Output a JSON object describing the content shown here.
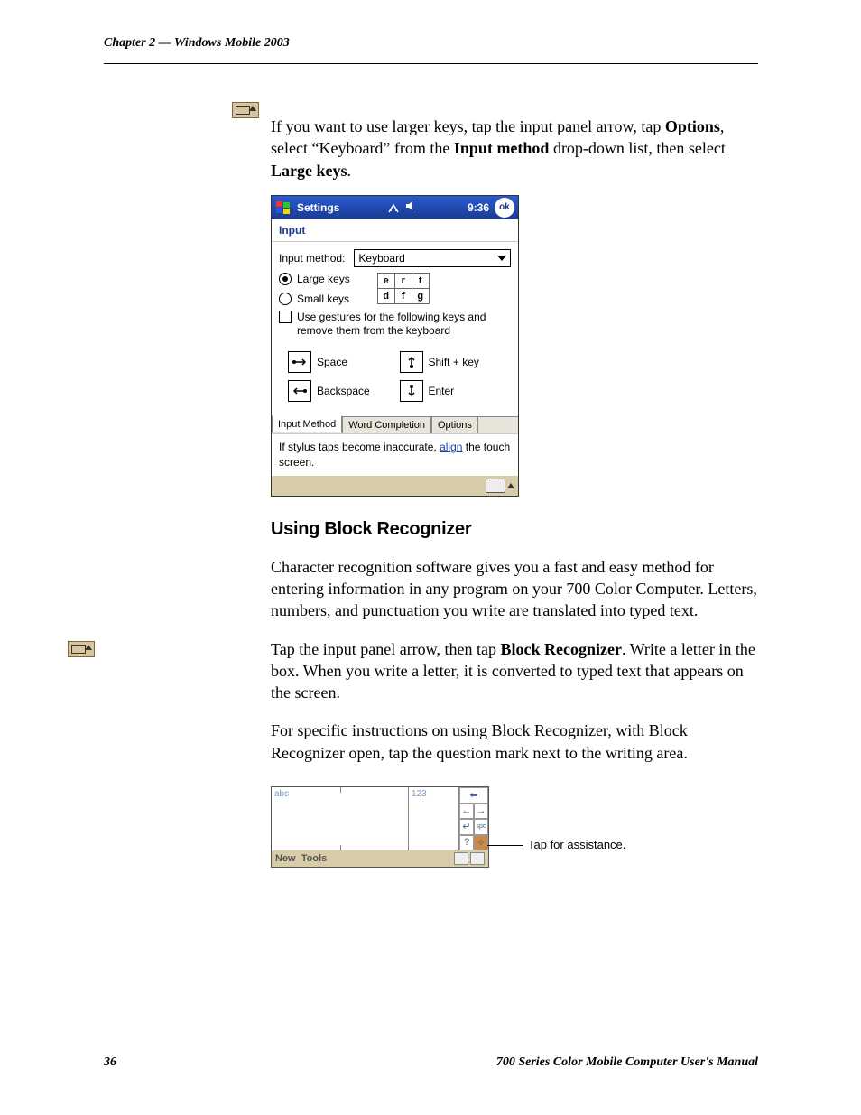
{
  "chapter_header": "Chapter 2 — Windows Mobile 2003",
  "footer": {
    "page_num": "36",
    "title": "700 Series Color Mobile Computer User's Manual"
  },
  "para1": {
    "pre": "If you want to use larger keys, tap the input panel arrow, tap ",
    "b1": "Options",
    "mid1": ", select “Keyboard” from the ",
    "b2": "Input method",
    "mid2": " drop-down list, then select ",
    "b3": "Large keys",
    "post": "."
  },
  "device1": {
    "title": "Settings",
    "time": "9:36",
    "ok": "ok",
    "subtitle": "Input",
    "input_method_label": "Input method:",
    "input_method_value": "Keyboard",
    "radio_large": "Large keys",
    "radio_small": "Small keys",
    "chk_gestures": "Use gestures for the following keys and remove them from the keyboard",
    "g_space": "Space",
    "g_shift": "Shift + key",
    "g_back": "Backspace",
    "g_enter": "Enter",
    "tabs": {
      "t1": "Input Method",
      "t2": "Word Completion",
      "t3": "Options"
    },
    "note_pre": "If stylus taps become inaccurate, ",
    "note_link": "align",
    "note_post": " the touch screen.",
    "sample_keys": {
      "r1": [
        "e",
        "r",
        "t"
      ],
      "r2": [
        "d",
        "f",
        "g"
      ]
    }
  },
  "heading2": "Using Block Recognizer",
  "para2": "Character recognition software gives you a fast and easy method for entering information in any program on your 700 Color Computer. Letters, numbers, and punctuation you write are translated into typed text.",
  "para3": {
    "pre": "Tap the input panel arrow, then tap ",
    "b1": "Block Recognizer",
    "post": ". Write a letter in the box. When you write a letter, it is converted to typed text that appears on the screen."
  },
  "para4": "For specific instructions on using Block Recognizer, with Block Recognizer open, tap the question mark next to the writing area.",
  "device2": {
    "abc_label": "abc",
    "num_label": "123",
    "footer_left1": "New",
    "footer_left2": "Tools",
    "callout": "Tap for assistance."
  }
}
